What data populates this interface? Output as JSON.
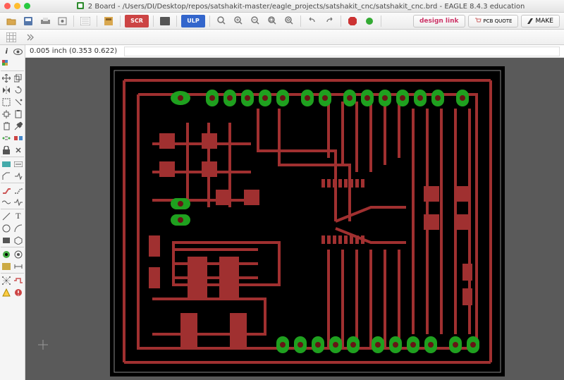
{
  "window": {
    "title": "2 Board - /Users/DI/Desktop/repos/satshakit-master/eagle_projects/satshakit_cnc/satshakit_cnc.brd - EAGLE 8.4.3 education"
  },
  "toolbar": {
    "scr_label": "SCR",
    "ulp_label": "ULP",
    "design_link": "design link",
    "pcb_quote": "PCB QUOTE",
    "make": "MAKE"
  },
  "coord": {
    "text": "0.005 inch (0.353 0.622)"
  },
  "tool_labels": {
    "info": "i",
    "eye": "eye",
    "text": "T",
    "lock": "lock"
  }
}
